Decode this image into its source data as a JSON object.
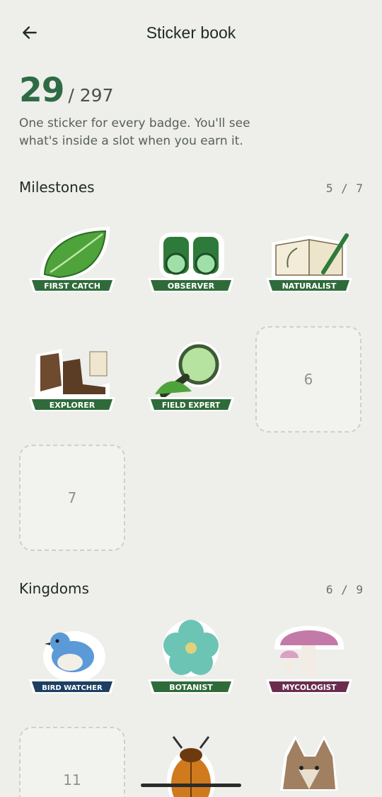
{
  "header": {
    "title": "Sticker book",
    "back_icon": "arrow-left-icon"
  },
  "progress": {
    "earned": "29",
    "total": "/ 297",
    "description": "One sticker for every badge. You'll see what's inside a slot when you earn it."
  },
  "sections": [
    {
      "title": "Milestones",
      "count": "5 / 7",
      "stickers": [
        {
          "label": "FIRST CATCH",
          "icon": "leaf-sticker",
          "earned": true
        },
        {
          "label": "OBSERVER",
          "icon": "binoculars-sticker",
          "earned": true
        },
        {
          "label": "NATURALIST",
          "icon": "notebook-sticker",
          "earned": true
        },
        {
          "label": "EXPLORER",
          "icon": "boots-sticker",
          "earned": true
        },
        {
          "label": "FIELD EXPERT",
          "icon": "magnifier-sticker",
          "earned": true
        },
        {
          "label": "6",
          "earned": false
        },
        {
          "label": "7",
          "earned": false
        }
      ]
    },
    {
      "title": "Kingdoms",
      "count": "6 / 9",
      "stickers": [
        {
          "label": "BIRD WATCHER",
          "icon": "bird-sticker",
          "earned": true
        },
        {
          "label": "BOTANIST",
          "icon": "flower-sticker",
          "earned": true
        },
        {
          "label": "MYCOLOGIST",
          "icon": "mushroom-sticker",
          "earned": true
        },
        {
          "label": "11",
          "earned": false
        },
        {
          "label": "",
          "icon": "beetle-sticker",
          "earned": true
        },
        {
          "label": "",
          "icon": "fox-sticker",
          "earned": true
        }
      ]
    }
  ],
  "colors": {
    "accent": "#2e6b45",
    "background": "#eeeeea",
    "banner_green": "#2f6b3a",
    "banner_navy": "#1d3f63",
    "banner_plum": "#6a2d4e"
  }
}
